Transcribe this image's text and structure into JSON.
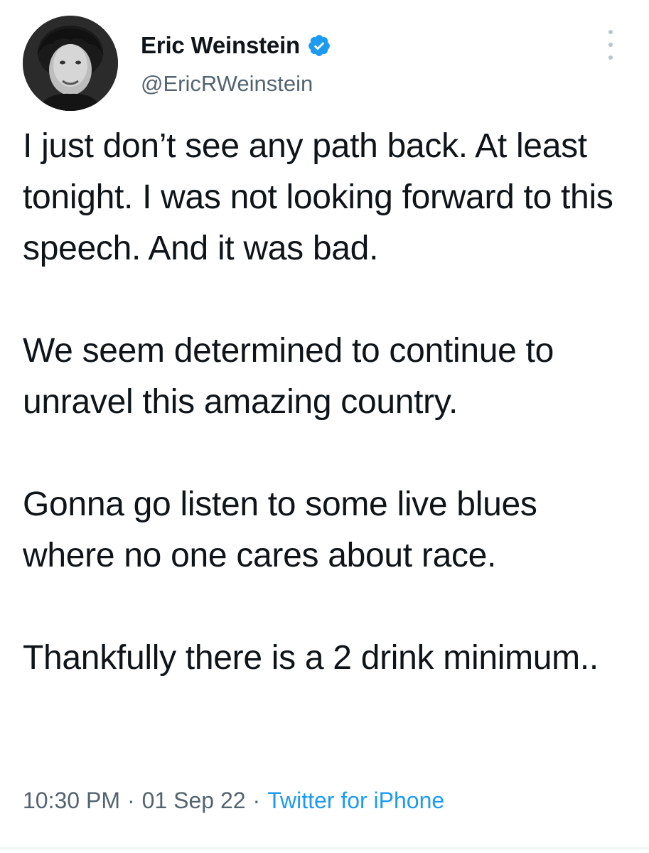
{
  "author": {
    "display_name": "Eric Weinstein",
    "handle": "@EricRWeinstein",
    "verified": true,
    "verified_color": "#1d9bf0",
    "avatar_icon": "profile-photo-icon"
  },
  "tweet": {
    "paragraphs": [
      "I just don’t see any path back. At least tonight. I was not looking forward to this speech. And it was bad.",
      "We seem determined to continue to unravel this amazing country.",
      "Gonna go listen to some live blues where no one cares about race.",
      "Thankfully there is a 2 drink minimum.."
    ],
    "time": "10:30 PM",
    "date": "01 Sep 22",
    "source": "Twitter for iPhone",
    "separator": "·"
  },
  "icons": {
    "more": "more-options-icon",
    "verified": "verified-badge-icon"
  },
  "colors": {
    "text_primary": "#0f1419",
    "text_secondary": "#536471",
    "link": "#1d9bf0"
  }
}
